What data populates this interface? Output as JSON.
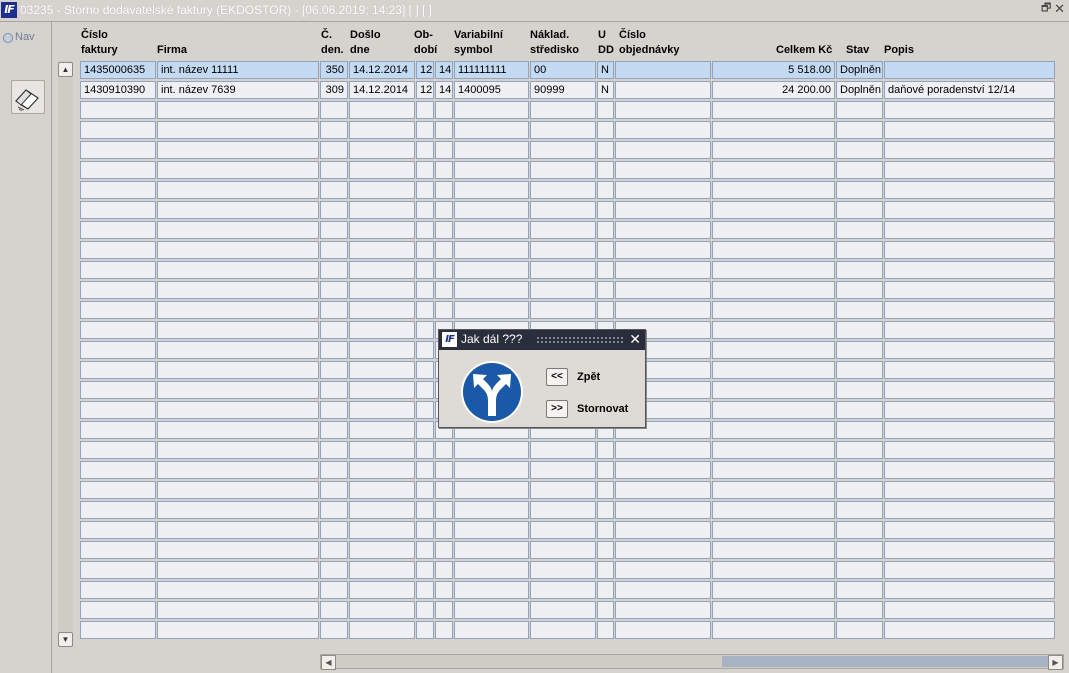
{
  "window": {
    "title": "03235 - Storno dodavatelské faktury (EKDOSTOR) - [06.06.2019; 14:23]  [  ]  [  ]",
    "app_icon_text": "IF"
  },
  "nav": {
    "label": "Nav"
  },
  "table": {
    "columns": [
      {
        "line1": "Číslo",
        "line2": "faktury"
      },
      {
        "line1": "",
        "line2": "Firma"
      },
      {
        "line1": "Č.",
        "line2": "den."
      },
      {
        "line1": "Došlo",
        "line2": "dne"
      },
      {
        "line1": "Ob-",
        "line2": "dobí"
      },
      {
        "line1": "Variabilní",
        "line2": "symbol"
      },
      {
        "line1": "Náklad.",
        "line2": "středisko"
      },
      {
        "line1": "U",
        "line2": "DD"
      },
      {
        "line1": "Číslo",
        "line2": "objednávky"
      },
      {
        "line1": "",
        "line2": "Celkem Kč"
      },
      {
        "line1": "",
        "line2": "Stav"
      },
      {
        "line1": "",
        "line2": "Popis"
      }
    ],
    "rows": [
      {
        "cislo_faktury": "1435000635",
        "firma": "int. název 11111",
        "c_den": "350",
        "doslo_dne": "14.12.2014",
        "obdobi_1": "12",
        "obdobi_2": "14",
        "variabilni_symbol": "111111111",
        "naklad_stredisko": "00",
        "udd": "N",
        "cislo_objednavky": "",
        "celkem_kc": "5 518.00",
        "stav": "Doplněn",
        "popis": ""
      },
      {
        "cislo_faktury": "1430910390",
        "firma": "int. název 7639",
        "c_den": "309",
        "doslo_dne": "14.12.2014",
        "obdobi_1": "12",
        "obdobi_2": "14",
        "variabilni_symbol": "1400095",
        "naklad_stredisko": "90999",
        "udd": "N",
        "cislo_objednavky": "",
        "celkem_kc": "24 200.00",
        "stav": "Doplněn",
        "popis": "daňové poradenství 12/14"
      }
    ],
    "selected_row": 0
  },
  "dialog": {
    "title": "Jak dál ???",
    "icon_text": "IF",
    "back_button": "<<",
    "back_label": "Zpět",
    "forward_button": ">>",
    "forward_label": "Stornovat"
  },
  "colors": {
    "selected_row": "#c4daf3",
    "cell_border": "#93a2bd",
    "sign_blue": "#1a59a8"
  }
}
